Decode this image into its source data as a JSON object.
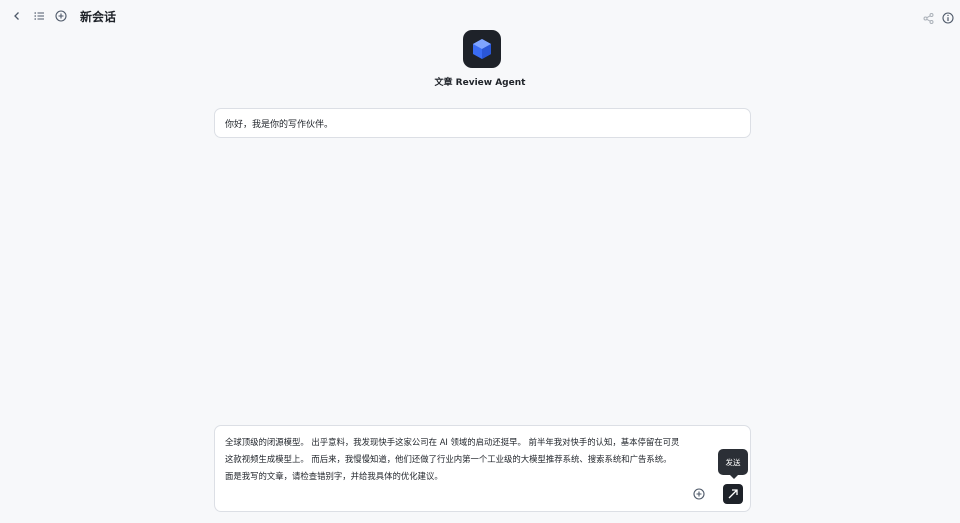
{
  "header": {
    "title": "新会话",
    "icons": [
      "back-icon",
      "list-icon",
      "new-chat-icon",
      "share-icon",
      "info-icon"
    ]
  },
  "agent": {
    "name": "文章 Review Agent",
    "logo_icon": "cube-logo-icon",
    "logo_color": "#3a6cf4"
  },
  "messages": [
    {
      "role": "assistant",
      "text": "你好，我是你的写作伙伴。"
    }
  ],
  "composer": {
    "text": "全球顶级的闭源模型。 出乎意料，我发现快手这家公司在 AI 领域的启动还挺早。 前半年我对快手的认知，基本停留在可灵\n这款视频生成模型上。 而后来，我慢慢知道，他们还做了行业内第一个工业级的大模型推荐系统、搜索系统和广告系统。\n面是我写的文章，请检查错别字，并给我具体的优化建议。",
    "send_tooltip": "发送"
  }
}
